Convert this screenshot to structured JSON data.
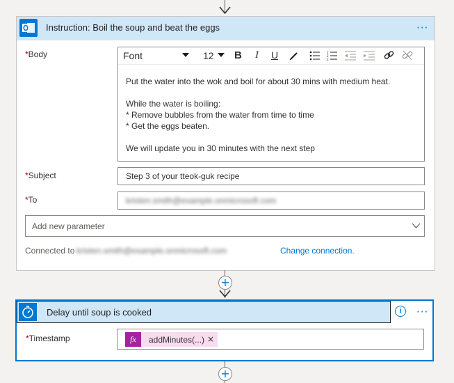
{
  "action1": {
    "title": "Instruction: Boil the soup and beat the eggs",
    "icon": "outlook-icon",
    "more": "···",
    "body_label": "Body",
    "required_mark": "*",
    "toolbar": {
      "font": "Font",
      "size": "12",
      "bold": "B",
      "italic": "I",
      "underline": "U"
    },
    "body_lines": [
      "Put the water into the wok and boil for about 30 mins with medium heat.",
      "",
      "While the water is boiling:",
      "* Remove bubbles from the water from time to time",
      "* Get the eggs beaten.",
      "",
      "We will update you in 30 minutes with the next step"
    ],
    "subject_label": "Subject",
    "subject_value": "Step 3 of your tteok-guk recipe",
    "to_label": "To",
    "to_value": "kristen.smith@example.onmicrosoft.com",
    "add_parameter_placeholder": "Add new parameter",
    "connected_to_label": "Connected to",
    "connected_to_value": "kristen.smith@example.onmicrosoft.com",
    "change_connection": "Change connection."
  },
  "action2": {
    "title": "Delay until soup is cooked",
    "icon": "timer-icon",
    "more": "···",
    "info": "i",
    "timestamp_label": "Timestamp",
    "required_mark": "*",
    "expression_icon": "fx",
    "expression_token": "addMinutes(...)",
    "remove_token": "×"
  },
  "colors": {
    "accent": "#0078d4",
    "header_bg": "#d0e7f8",
    "expression": "#a4219f",
    "token_bg": "#f9dbef"
  }
}
